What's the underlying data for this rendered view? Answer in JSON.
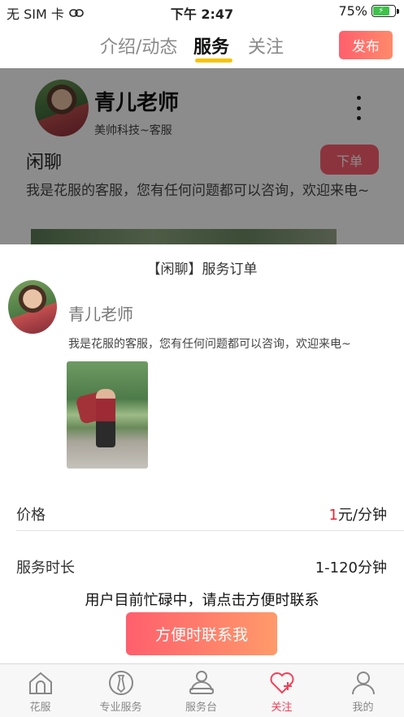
{
  "status_bar": {
    "carrier": "无 SIM 卡",
    "time": "下午 2:47",
    "battery": "75%"
  },
  "top_nav": {
    "tabs": [
      {
        "label": "介绍/动态"
      },
      {
        "label": "服务"
      },
      {
        "label": "关注"
      }
    ],
    "active_tab": "服务",
    "publish_label": "发布",
    "accent_color": "#f5c40a"
  },
  "background_card": {
    "name": "青儿老师",
    "company": "美帅科技~客服",
    "service_title": "闲聊",
    "order_label": "下单",
    "description": "我是花服的客服，您有任何问题都可以咨询，欢迎来电~"
  },
  "order_sheet": {
    "title": "【闲聊】服务订单",
    "name": "青儿老师",
    "description": "我是花服的客服，您有任何问题都可以咨询，欢迎来电~",
    "price_label": "价格",
    "price_amount": "1",
    "price_unit": "元/分钟",
    "duration_label": "服务时长",
    "duration_value": "1-120分钟",
    "busy_text": "用户目前忙碌中，请点击方便时联系",
    "contact_label": "方便时联系我"
  },
  "bottom_bar": {
    "items": [
      {
        "label": "花服",
        "icon": "home-icon"
      },
      {
        "label": "专业服务",
        "icon": "tie-icon"
      },
      {
        "label": "服务台",
        "icon": "service-desk-icon"
      },
      {
        "label": "关注",
        "icon": "heart-plus-icon"
      },
      {
        "label": "我的",
        "icon": "person-icon"
      }
    ],
    "active": "关注",
    "active_color": "#f0405a"
  }
}
